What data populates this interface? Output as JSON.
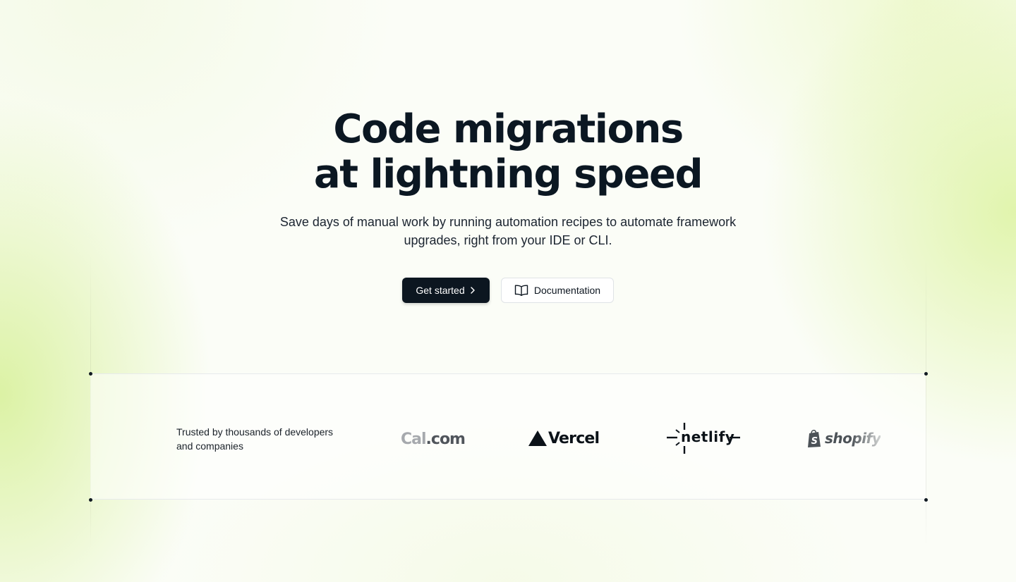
{
  "hero": {
    "title_line1": "Code migrations",
    "title_line2": "at lightning speed",
    "subtitle": "Save days of manual work by running automation recipes to automate framework upgrades, right from your IDE or CLI."
  },
  "cta": {
    "primary_label": "Get started",
    "primary_icon": "chevron-right-icon",
    "secondary_label": "Documentation",
    "secondary_icon": "book-open-icon"
  },
  "trusted": {
    "text": "Trusted by thousands of developers and companies",
    "logos": [
      {
        "name": "Cal.com",
        "part1": "Cal",
        "part2": ".com"
      },
      {
        "name": "Vercel",
        "text": "Vercel"
      },
      {
        "name": "netlify",
        "text": "netlify"
      },
      {
        "name": "shopify",
        "text": "shopify"
      }
    ]
  },
  "colors": {
    "primary_button": "#0c1620",
    "text": "#0b1722",
    "accent_gradient": "#d6f096"
  }
}
